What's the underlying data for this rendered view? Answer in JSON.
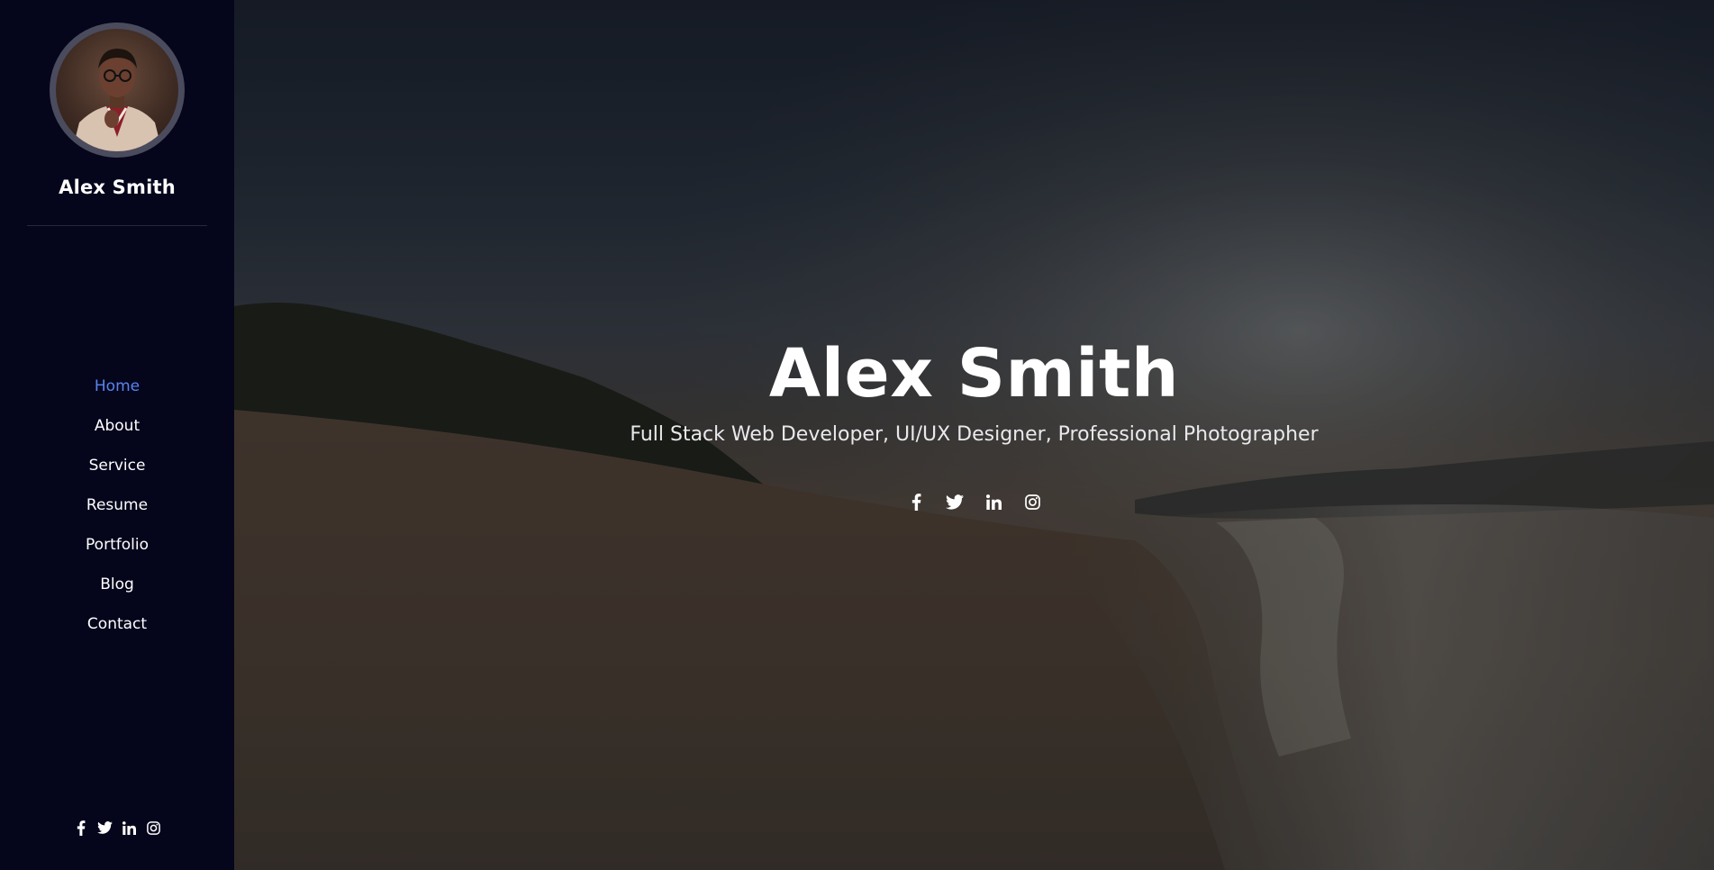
{
  "sidebar": {
    "name": "Alex Smith",
    "avatar_alt": "Profile photo",
    "nav": [
      {
        "label": "Home",
        "active": true
      },
      {
        "label": "About",
        "active": false
      },
      {
        "label": "Service",
        "active": false
      },
      {
        "label": "Resume",
        "active": false
      },
      {
        "label": "Portfolio",
        "active": false
      },
      {
        "label": "Blog",
        "active": false
      },
      {
        "label": "Contact",
        "active": false
      }
    ],
    "social_icons": [
      "facebook-icon",
      "twitter-icon",
      "linkedin-icon",
      "instagram-icon"
    ]
  },
  "hero": {
    "title": "Alex Smith",
    "subtitle": "Full Stack Web Developer, UI/UX Designer, Professional Photographer",
    "social_icons": [
      "facebook-icon",
      "twitter-icon",
      "linkedin-icon",
      "instagram-icon"
    ]
  },
  "colors": {
    "sidebar_bg": "#05061c",
    "accent": "#5a83f1",
    "text": "#ffffff"
  }
}
